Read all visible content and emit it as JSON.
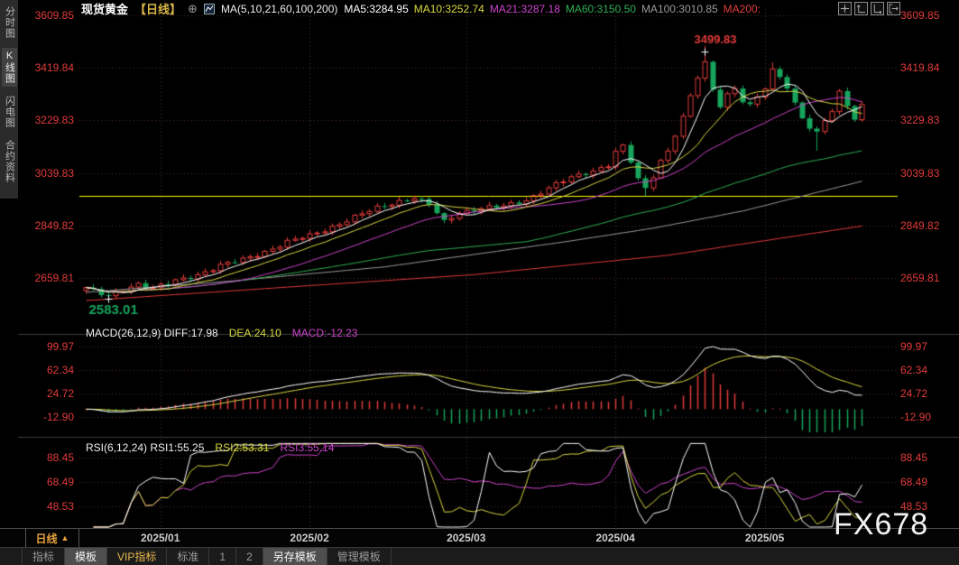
{
  "header": {
    "title": "现货黄金",
    "period_tag": "【日线】",
    "add_icon": "⊕",
    "ma_label": "MA(5,10,21,60,100,200)",
    "ma_items": [
      {
        "label": "MA5:3284.95",
        "color": "#ffffff"
      },
      {
        "label": "MA10:3252.74",
        "color": "#d8d843"
      },
      {
        "label": "MA21:3287.18",
        "color": "#cc44cc"
      },
      {
        "label": "MA60:3150.50",
        "color": "#2fae55"
      },
      {
        "label": "MA100:3010.85",
        "color": "#9a9a9a"
      },
      {
        "label": "MA200:",
        "color": "#e23b3b"
      }
    ]
  },
  "sidebar": {
    "items": [
      {
        "label": "分时图",
        "selected": false
      },
      {
        "label": "K线图",
        "selected": true
      },
      {
        "label": "闪电图",
        "selected": false
      },
      {
        "label": "合约资料",
        "selected": false
      }
    ]
  },
  "macd_header": {
    "main": "MACD(26,12,9) DIFF:17.98",
    "dea": "DEA:24.10",
    "macd": "MACD:-12.23"
  },
  "rsi_header": {
    "main": "RSI(6,12,24) RSI1:55.25",
    "rsi2": "RSI2:53.31",
    "rsi3": "RSI3:55.14"
  },
  "xaxis": {
    "period_label": "日线",
    "arrow": "▲",
    "dates": [
      "2025/01",
      "2025/02",
      "2025/03",
      "2025/04",
      "2025/05"
    ]
  },
  "toolbar": {
    "items": [
      {
        "label": "指标",
        "style": "normal"
      },
      {
        "label": "模板",
        "style": "selected"
      },
      {
        "label": "VIP指标",
        "style": "vip"
      },
      {
        "label": "标准",
        "style": "normal"
      },
      {
        "label": "1",
        "style": "normal"
      },
      {
        "label": "2",
        "style": "normal"
      },
      {
        "label": "另存模板",
        "style": "selected"
      },
      {
        "label": "管理模板",
        "style": "normal"
      }
    ]
  },
  "watermark": "FX678",
  "colors": {
    "up": "#e23b3b",
    "down": "#17a45c",
    "ma5": "#ffffff",
    "ma10": "#d8d843",
    "ma21": "#cc44cc",
    "ma60": "#2fae55",
    "ma100": "#9a9a9a",
    "ma200": "#e23b3b",
    "axis_label": "#e23b3b",
    "hline": "#ffff00",
    "diff": "#ffffff",
    "dea": "#d8d843",
    "hist_pos": "#e23b3b",
    "hist_neg": "#17a45c",
    "rsi1": "#ffffff",
    "rsi2": "#d8d843",
    "rsi3": "#cc44cc",
    "grid_h": "#5a2a2a",
    "grid_v": "#3a3a3a"
  },
  "chart_data": {
    "type": "candlestick",
    "title": "现货黄金 日线 (spot gold daily)",
    "price_axis_ticks": [
      3609.85,
      3419.84,
      3229.83,
      3039.83,
      2849.82,
      2659.81
    ],
    "macd_axis_ticks": [
      99.97,
      62.34,
      24.72,
      -12.9
    ],
    "rsi_axis_ticks": [
      88.45,
      68.49,
      48.53
    ],
    "x_tick_labels": [
      "2025/01",
      "2025/02",
      "2025/03",
      "2025/04",
      "2025/05"
    ],
    "x_tick_indices": [
      10,
      30,
      51,
      71,
      91
    ],
    "candle_count": 105,
    "high_marker": {
      "index": 83,
      "price": 3499.83,
      "label": "3499.83"
    },
    "low_marker": {
      "index": 3,
      "price": 2583.01,
      "label": "2583.01"
    },
    "horizontal_line_price": 2956.9,
    "ma_current": {
      "MA5": 3284.95,
      "MA10": 3252.74,
      "MA21": 3287.18,
      "MA60": 3150.5,
      "MA100": 3010.85,
      "MA200": null
    },
    "macd_values": {
      "params": [
        26,
        12,
        9
      ],
      "diff": 17.98,
      "dea": 24.1,
      "macd": -12.23
    },
    "rsi_values": {
      "params": [
        6,
        12,
        24
      ],
      "rsi1": 55.25,
      "rsi2": 53.31,
      "rsi3": 55.14
    },
    "close_anchors": [
      [
        0,
        2625
      ],
      [
        2,
        2600
      ],
      [
        3,
        2592
      ],
      [
        5,
        2618
      ],
      [
        7,
        2640
      ],
      [
        9,
        2622
      ],
      [
        12,
        2648
      ],
      [
        15,
        2672
      ],
      [
        18,
        2705
      ],
      [
        21,
        2725
      ],
      [
        24,
        2755
      ],
      [
        27,
        2790
      ],
      [
        30,
        2812
      ],
      [
        33,
        2845
      ],
      [
        36,
        2880
      ],
      [
        39,
        2912
      ],
      [
        42,
        2938
      ],
      [
        44,
        2950
      ],
      [
        46,
        2925
      ],
      [
        48,
        2862
      ],
      [
        50,
        2898
      ],
      [
        53,
        2912
      ],
      [
        56,
        2918
      ],
      [
        59,
        2942
      ],
      [
        62,
        2985
      ],
      [
        65,
        3022
      ],
      [
        68,
        3048
      ],
      [
        70,
        3070
      ],
      [
        71,
        3115
      ],
      [
        72,
        3135
      ],
      [
        73,
        3080
      ],
      [
        74,
        3015
      ],
      [
        75,
        2982
      ],
      [
        76,
        3030
      ],
      [
        77,
        3085
      ],
      [
        78,
        3120
      ],
      [
        79,
        3180
      ],
      [
        80,
        3240
      ],
      [
        81,
        3315
      ],
      [
        82,
        3385
      ],
      [
        83,
        3435
      ],
      [
        84,
        3340
      ],
      [
        85,
        3285
      ],
      [
        86,
        3325
      ],
      [
        87,
        3348
      ],
      [
        88,
        3302
      ],
      [
        89,
        3282
      ],
      [
        90,
        3312
      ],
      [
        91,
        3345
      ],
      [
        92,
        3408
      ],
      [
        93,
        3388
      ],
      [
        94,
        3352
      ],
      [
        95,
        3292
      ],
      [
        96,
        3242
      ],
      [
        97,
        3205
      ],
      [
        98,
        3182
      ],
      [
        99,
        3228
      ],
      [
        100,
        3262
      ],
      [
        101,
        3328
      ],
      [
        102,
        3285
      ],
      [
        103,
        3238
      ],
      [
        104,
        3285
      ]
    ],
    "wick_overrides": {
      "3": {
        "low": 2583.01
      },
      "75": {
        "low": 2956
      },
      "83": {
        "high": 3499.83
      },
      "92": {
        "high": 3440
      },
      "98": {
        "low": 3120
      }
    },
    "ma100_anchors": [
      [
        0,
        2608
      ],
      [
        20,
        2650
      ],
      [
        40,
        2700
      ],
      [
        52,
        2745
      ],
      [
        64,
        2790
      ],
      [
        76,
        2840
      ],
      [
        88,
        2902
      ],
      [
        104,
        3010
      ]
    ],
    "ma200_anchors": [
      [
        0,
        2578
      ],
      [
        26,
        2625
      ],
      [
        52,
        2672
      ],
      [
        78,
        2742
      ],
      [
        104,
        2848
      ]
    ]
  }
}
